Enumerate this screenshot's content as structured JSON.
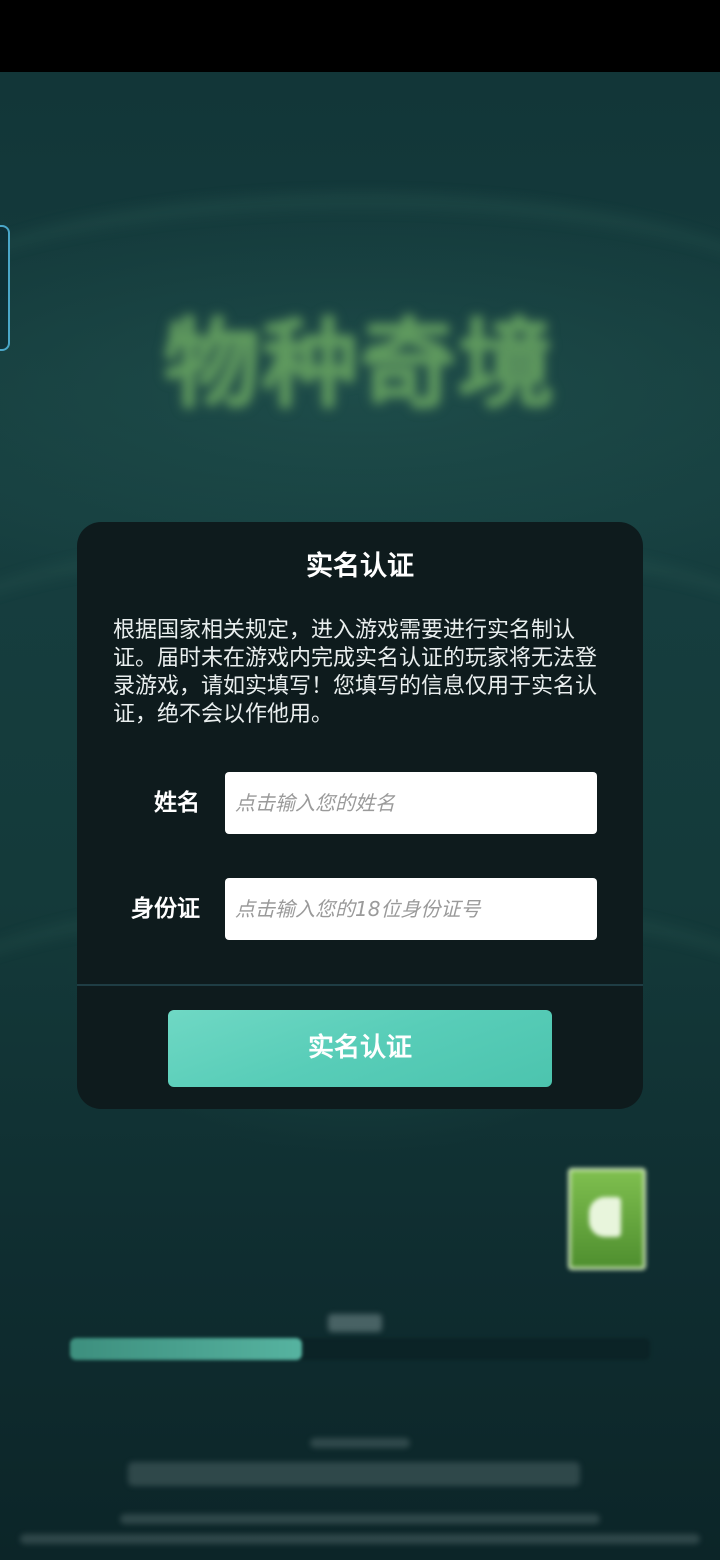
{
  "background": {
    "game_logo_text": "物种奇境",
    "loading_progress": 0.4
  },
  "dialog": {
    "title": "实名认证",
    "notice": "根据国家相关规定，进入游戏需要进行实名制认证。届时未在游戏内完成实名认证的玩家将无法登录游戏，请如实填写！您填写的信息仅用于实名认证，绝不会以作他用。",
    "name_field": {
      "label": "姓名",
      "placeholder": "点击输入您的姓名",
      "value": ""
    },
    "id_field": {
      "label": "身份证",
      "placeholder": "点击输入您的18位身份证号",
      "value": ""
    },
    "submit_label": "实名认证"
  },
  "colors": {
    "dialog_bg": "#0e1b1d",
    "accent": "#5ccfb9",
    "page_bg": "#123638"
  }
}
